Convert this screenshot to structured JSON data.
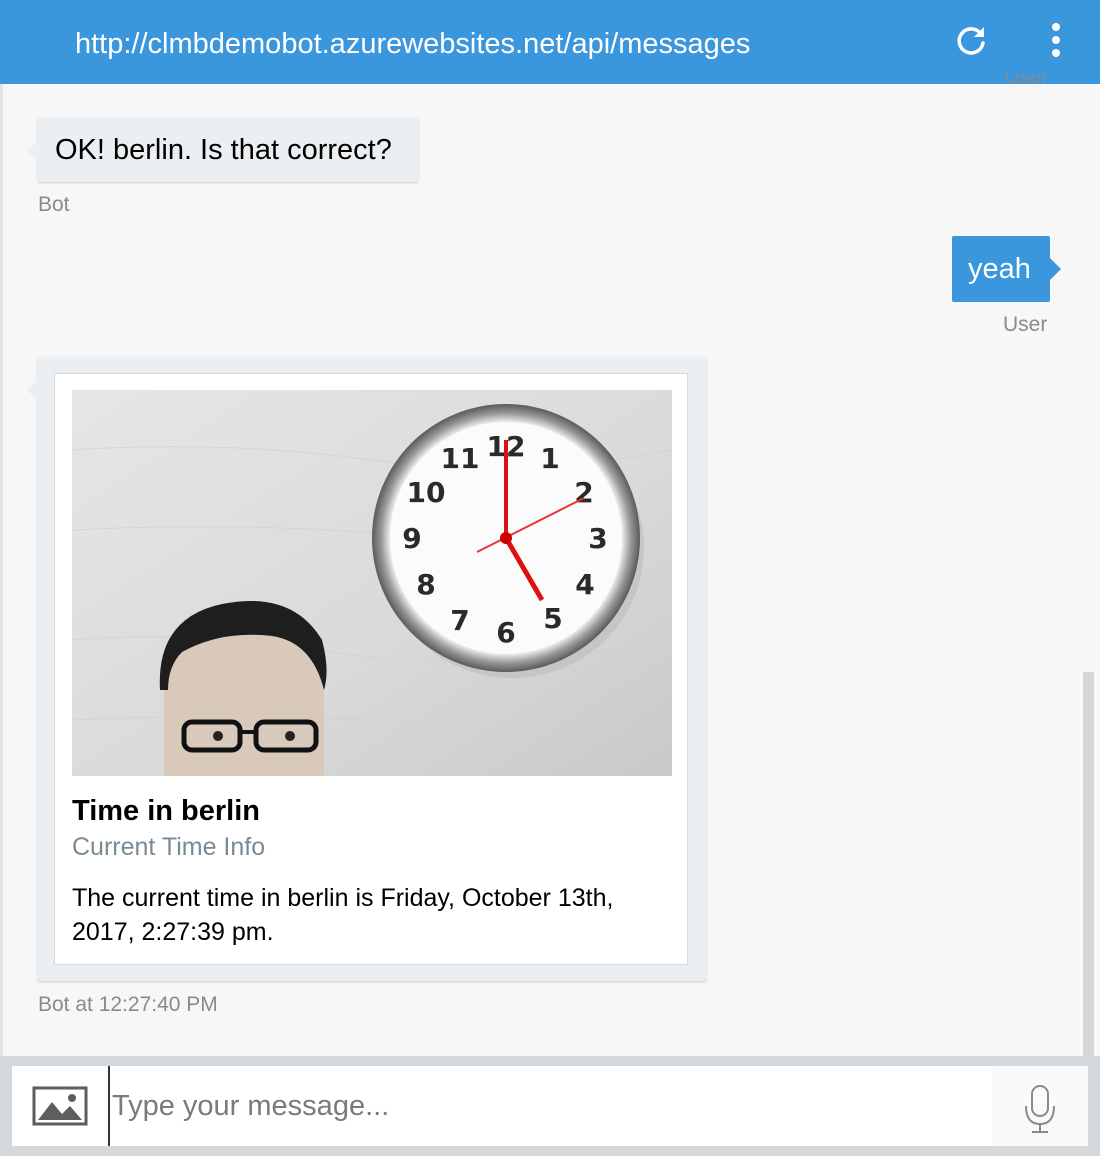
{
  "header": {
    "url": "http://clmbdemobot.azurewebsites.net/api/messages",
    "refresh_icon": "refresh-icon",
    "more_icon": "more-vertical-icon"
  },
  "messages": {
    "partial_user_label": "User",
    "bot_message": "OK! berlin. Is that correct?",
    "bot_label": "Bot",
    "user_message": "yeah",
    "user_label": "User",
    "card": {
      "title": "Time in berlin",
      "subtitle": "Current Time Info",
      "text": "The current time in berlin is Friday, October 13th, 2017, 2:27:39 pm."
    },
    "card_label": "Bot at 12:27:40 PM"
  },
  "input": {
    "placeholder": "Type your message...",
    "image_icon": "image-upload-icon",
    "mic_icon": "microphone-icon"
  },
  "colors": {
    "accent": "#3a96dd",
    "bubble_bot": "#eceff1",
    "background": "#f7f7f7"
  }
}
